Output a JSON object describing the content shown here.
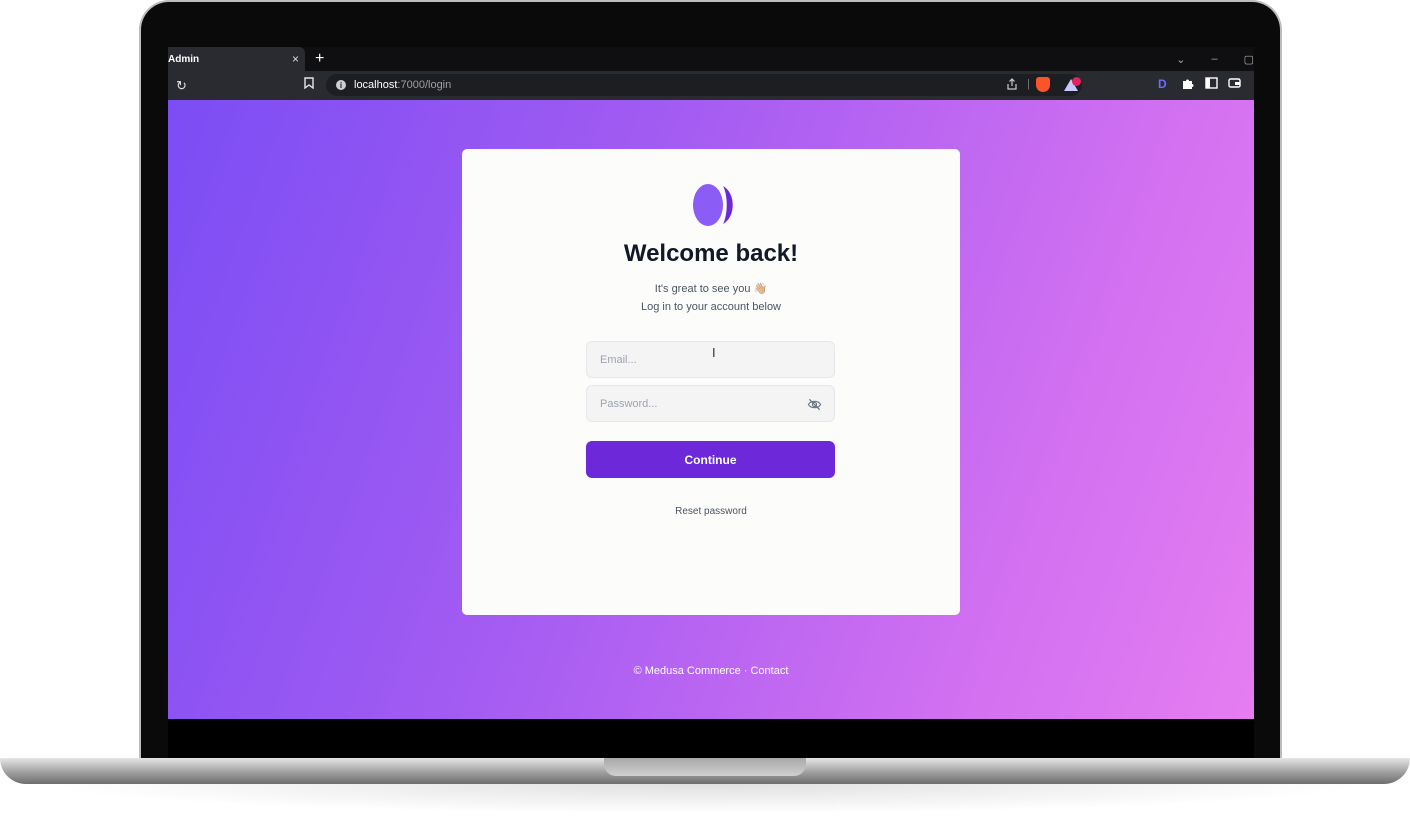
{
  "browser": {
    "tab_title": "Admin",
    "tab_close": "×",
    "new_tab": "+",
    "window_controls": [
      "⌄",
      "–",
      "▢"
    ],
    "reload_icon": "↻",
    "url_host": "localhost",
    "url_path": ":7000/login",
    "extension_d": "D"
  },
  "login": {
    "heading": "Welcome back!",
    "subtitle_line1": "It's great to see you 👋🏼",
    "subtitle_line2": "Log in to your account below",
    "email_placeholder": "Email...",
    "password_placeholder": "Password...",
    "continue_label": "Continue",
    "reset_label": "Reset password",
    "accent_color": "#6d28d9"
  },
  "footer": {
    "text": "© Medusa Commerce · Contact"
  }
}
